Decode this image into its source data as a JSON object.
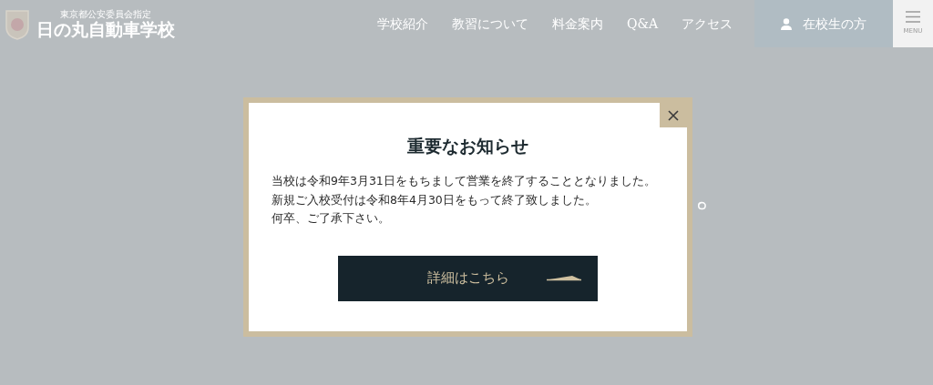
{
  "header": {
    "logo_caption": "東京都公安委員会指定",
    "logo_name": "日の丸自動車学校",
    "nav": [
      "学校紹介",
      "教習について",
      "料金案内",
      "Q&A",
      "アクセス"
    ],
    "student_link": "在校生の方",
    "menu_label": "MENU"
  },
  "hero": {
    "visible_fragment": "。"
  },
  "modal": {
    "title": "重要なお知らせ",
    "lines": [
      "当校は令和9年3月31日をもちまして営業を終了することとなりました。",
      "新規ご入校受付は令和8年4月30日をもって終了致しました。",
      "何卒、ご了承下さい。"
    ],
    "button": "詳細はこちら"
  }
}
